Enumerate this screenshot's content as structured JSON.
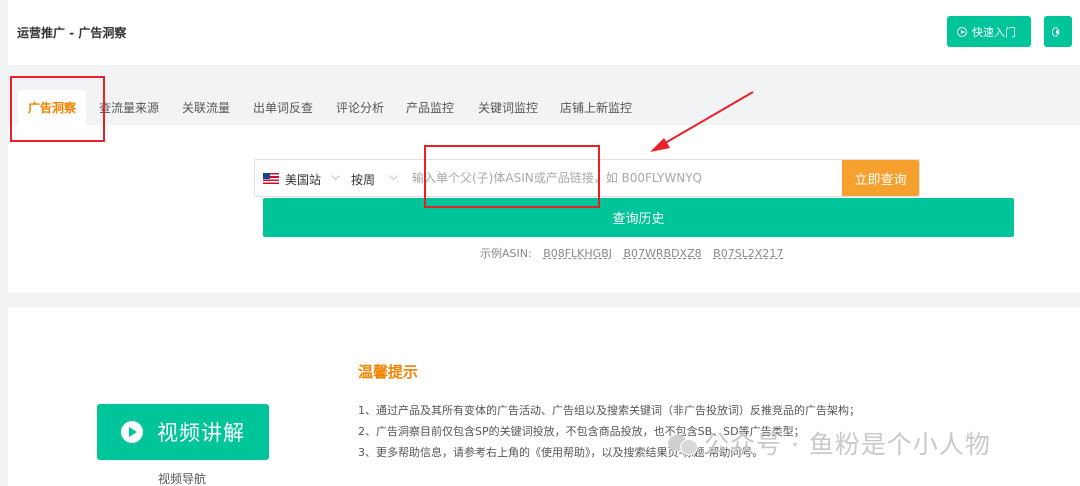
{
  "header": {
    "breadcrumb": "运营推广 - 广告洞察",
    "quick_start_label": "快速入门",
    "second_button_label": "",
    "accent_color": "#00c49a"
  },
  "tabs": [
    {
      "label": "广告洞察",
      "active": true
    },
    {
      "label": "查流量来源",
      "active": false
    },
    {
      "label": "关联流量",
      "active": false
    },
    {
      "label": "出单词反查",
      "active": false
    },
    {
      "label": "评论分析",
      "active": false
    },
    {
      "label": "产品监控",
      "active": false
    },
    {
      "label": "关键词监控",
      "active": false
    },
    {
      "label": "店铺上新监控",
      "active": false
    }
  ],
  "search": {
    "site": "美国站",
    "site_icon": "us-flag-icon",
    "period": "按周",
    "placeholder": "输入单个父(子)体ASIN或产品链接，如 B00FLYWNYQ",
    "value": "",
    "submit_label": "立即查询",
    "submit_color": "#f6a12d"
  },
  "history_label": "查询历史",
  "examples": {
    "label": "示例ASIN:",
    "asins": [
      "B08FLKHGBJ",
      "B07WRBDXZ8",
      "B07SL2X217"
    ]
  },
  "video": {
    "button_label": "视频讲解",
    "nav_label": "视频导航"
  },
  "tips": {
    "title": "温馨提示",
    "items": [
      "1、通过产品及其所有变体的广告活动、广告组以及搜索关键词（非广告投放词）反推竞品的广告架构；",
      "2、广告洞察目前仅包含SP的关键词投放，不包含商品投放，也不包含SB、SD等广告类型；",
      "3、更多帮助信息，请参考右上角的《使用帮助》，以及搜索结果页-标题-帮助问号。"
    ]
  },
  "watermark": {
    "text": "公众号 · 鱼粉是个小人物"
  }
}
